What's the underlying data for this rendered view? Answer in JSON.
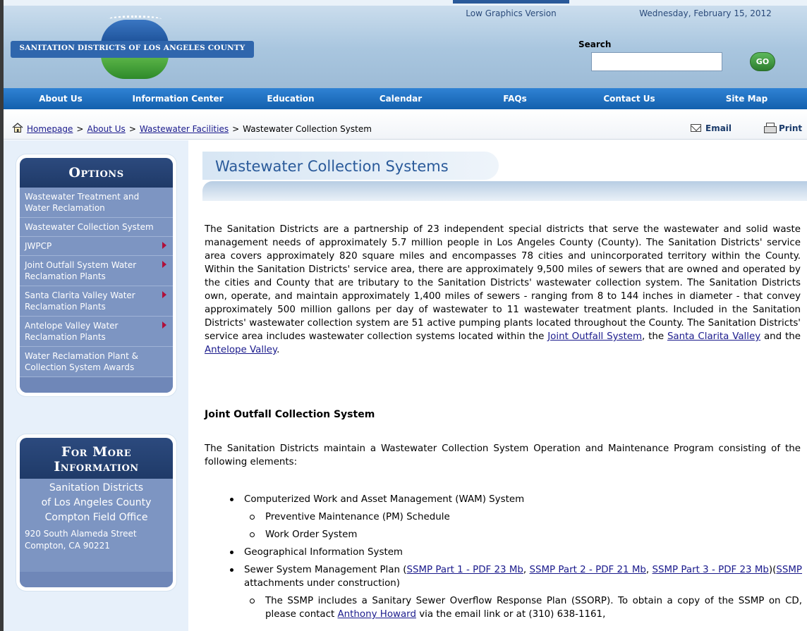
{
  "header": {
    "logo_text": "SANITATION DISTRICTS OF LOS ANGELES COUNTY",
    "low_graphics_label": "Low Graphics Version",
    "date": "Wednesday, February 15, 2012",
    "search_label": "Search",
    "search_value": "",
    "go_label": "GO"
  },
  "nav": [
    "About Us",
    "Information Center",
    "Education",
    "Calendar",
    "FAQs",
    "Contact Us",
    "Site Map"
  ],
  "breadcrumb": {
    "items": [
      "Homepage",
      "About Us",
      "Wastewater Facilities",
      "Wastewater Collection System"
    ],
    "separator": ">",
    "email_label": "Email",
    "print_label": "Print"
  },
  "sidebar": {
    "options_title": "Options",
    "options": [
      {
        "label": "Wastewater Treatment and Water Reclamation",
        "has_submenu": false
      },
      {
        "label": "Wastewater Collection System",
        "has_submenu": false
      },
      {
        "label": "JWPCP",
        "has_submenu": true
      },
      {
        "label": "Joint Outfall System Water Reclamation Plants",
        "has_submenu": true
      },
      {
        "label": "Santa Clarita Valley Water Reclamation Plants",
        "has_submenu": true
      },
      {
        "label": "Antelope Valley Water Reclamation Plants",
        "has_submenu": true
      },
      {
        "label": "Water Reclamation Plant & Collection System Awards",
        "has_submenu": false
      }
    ],
    "info_title": "For More Information",
    "info_lines": [
      "Sanitation Districts",
      "of Los Angeles County",
      "Compton Field Office"
    ],
    "address_line1": "920 South Alameda Street",
    "address_line2": "Compton, CA 90221"
  },
  "main": {
    "title": "Wastewater Collection Systems",
    "intro_text": "The Sanitation Districts are a partnership of 23 independent special districts that serve the wastewater and solid waste management needs of approximately 5.7 million people in Los Angeles County (County). The Sanitation Districts' service area covers approximately 820 square miles and encompasses 78 cities and unincorporated territory within the County. Within the Sanitation Districts' service area, there are approximately 9,500 miles of sewers that are owned and operated by the cities and County that are tributary to the Sanitation Districts' wastewater collection system. The Sanitation Districts own, operate, and maintain approximately 1,400 miles of sewers - ranging from 8 to 144 inches in diameter - that convey approximately 500 million gallons per day of wastewater to 11 wastewater treatment plants. Included in the Sanitation Districts' wastewater collection system are 51 active pumping plants located throughout the County. The Sanitation Districts' service area includes wastewater collection systems located within the",
    "intro_link1": "Joint Outfall System",
    "intro_mid1": ", the",
    "intro_link2": "Santa Clarita Valley",
    "intro_mid2": "and the",
    "intro_link3": "Antelope Valley",
    "intro_end": ".",
    "section_heading": "Joint Outfall Collection System",
    "section_intro": "The Sanitation Districts maintain a Wastewater Collection System Operation and Maintenance Program consisting of the following elements:",
    "bullets": {
      "wam": "Computerized Work and Asset Management (WAM) System",
      "pm": "Preventive Maintenance (PM) Schedule",
      "work_order": "Work Order System",
      "gis": "Geographical Information System",
      "ssmp_prefix": "Sewer System Management Plan (",
      "ssmp_part1": "SSMP Part 1 - PDF 23 Mb",
      "ssmp_comma1": ",",
      "ssmp_part2": "SSMP Part 2 - PDF 21 Mb",
      "ssmp_comma2": ",",
      "ssmp_part3": "SSMP Part 3 - PDF 23 Mb",
      "ssmp_paren": ")(",
      "ssmp_link": "SSMP",
      "ssmp_suffix": "attachments under construction)",
      "ssorp_prefix": "The SSMP includes a Sanitary Sewer Overflow Response Plan (SSORP). To obtain a copy of the SSMP on CD, please contact",
      "ssorp_contact": "Anthony Howard",
      "ssorp_suffix": "via the email link or at (310) 638-1161,"
    }
  },
  "colors": {
    "nav_blue": "#1a6cc0",
    "panel_head": "#24406f",
    "panel_body": "#7d95c2",
    "title_blue": "#2a5a9a",
    "go_green": "#3a9a3a",
    "arrow_red": "#b0103a"
  }
}
